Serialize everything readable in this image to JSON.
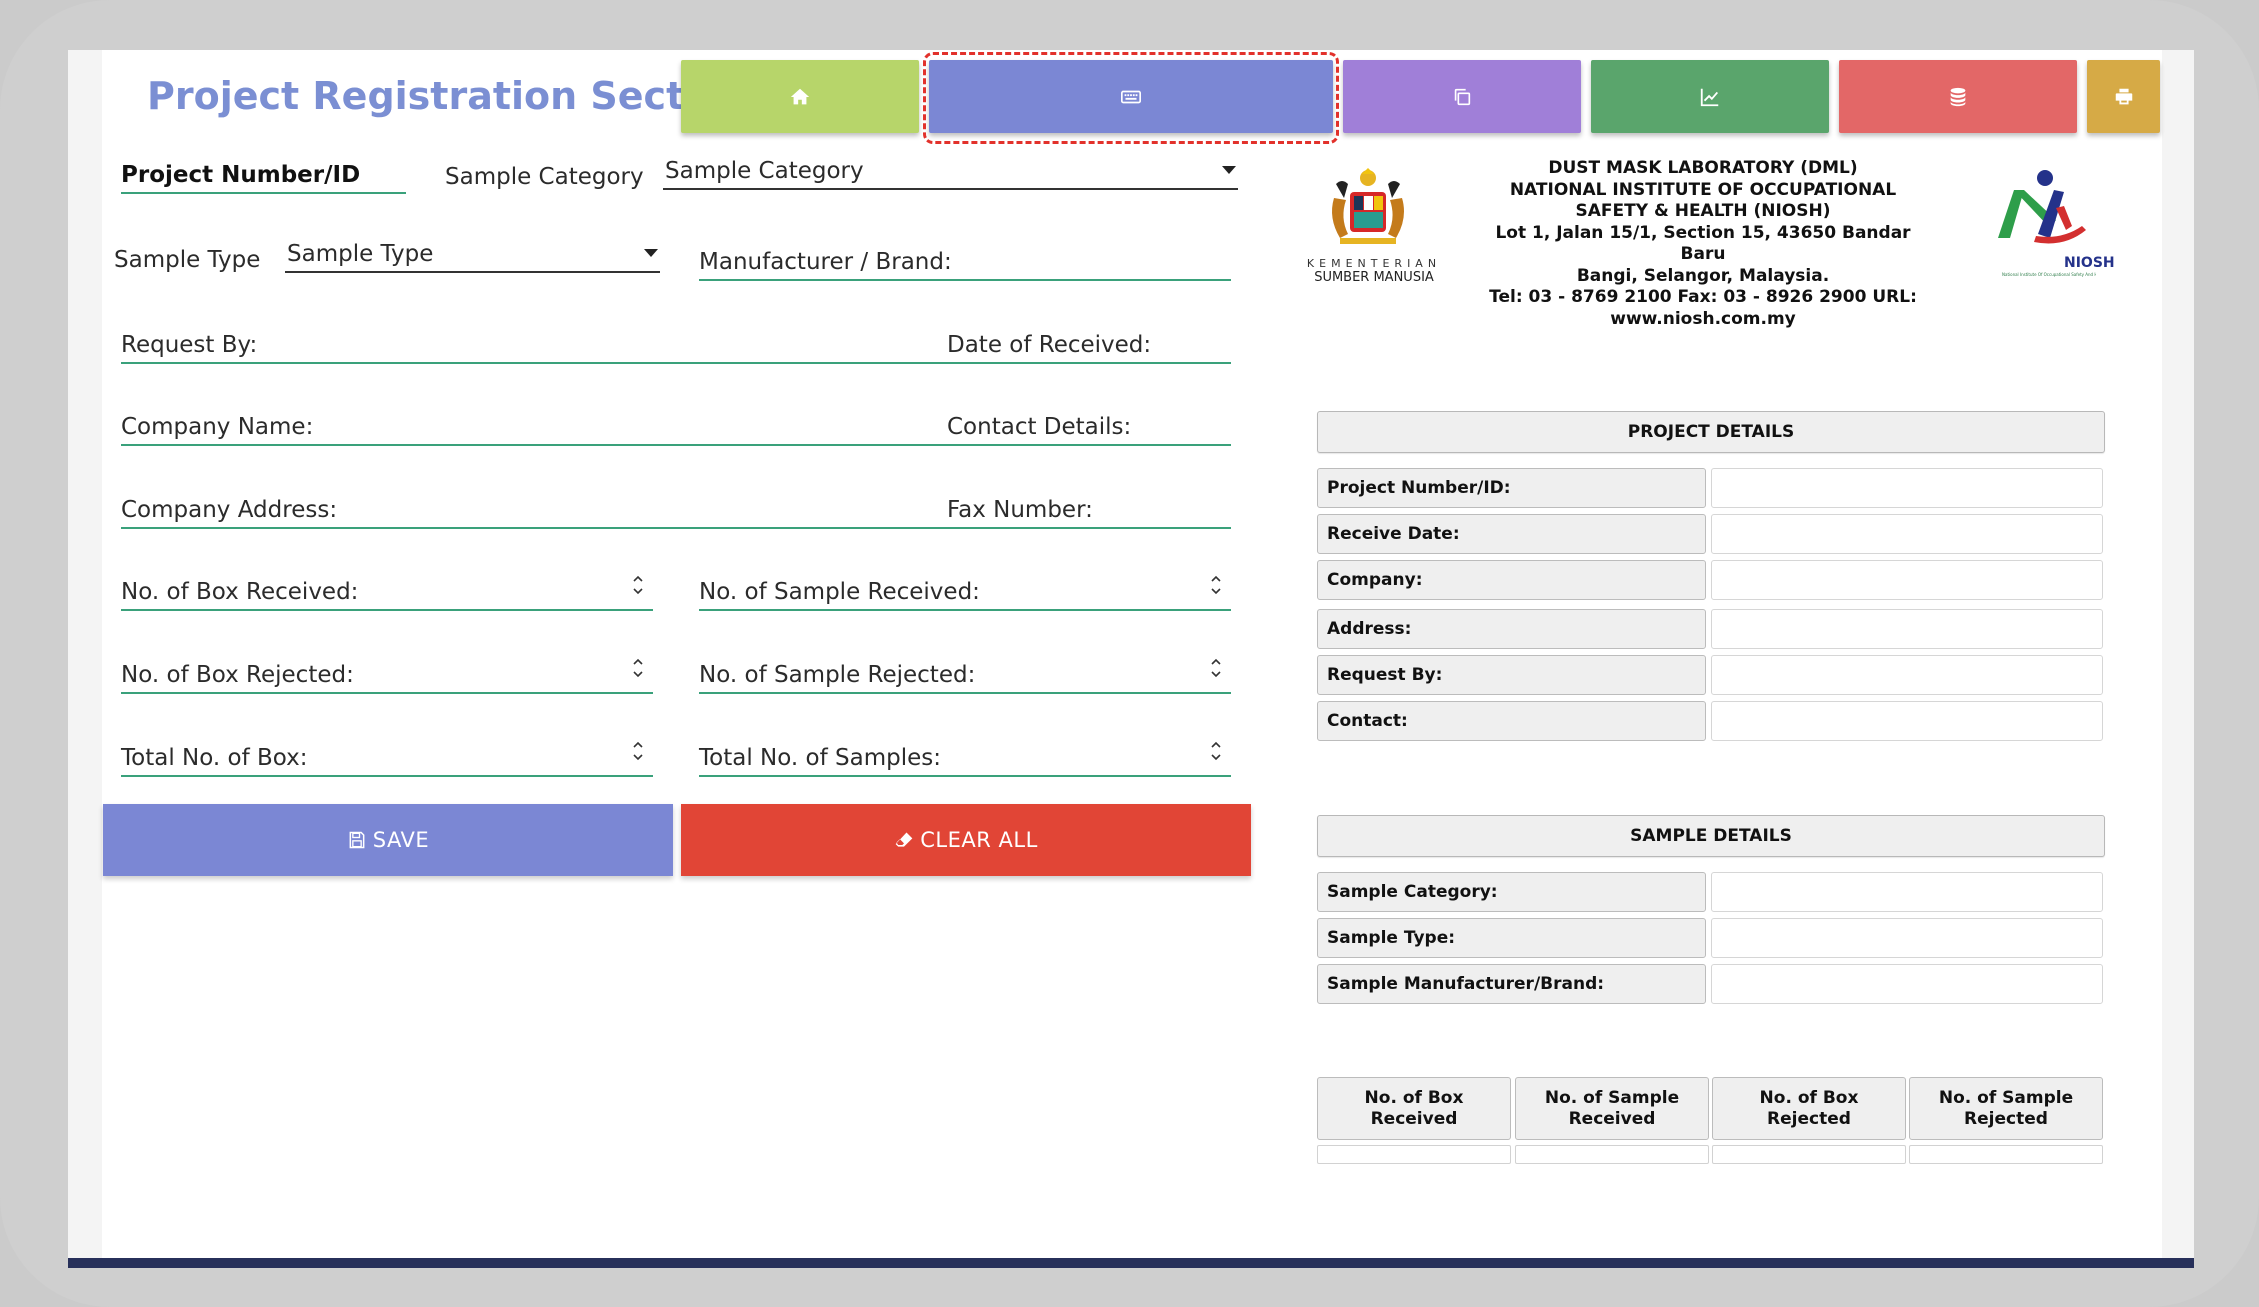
{
  "page": {
    "title": "Project Registration Section"
  },
  "nav": {
    "buttons": [
      {
        "name": "home",
        "icon": "home-icon",
        "color": "#b7d56a"
      },
      {
        "name": "keyboard",
        "icon": "keyboard-icon",
        "color": "#7b87d4",
        "active": true
      },
      {
        "name": "copy",
        "icon": "copy-icon",
        "color": "#a07fd8"
      },
      {
        "name": "chart",
        "icon": "chart-line-icon",
        "color": "#5aa56c"
      },
      {
        "name": "database",
        "icon": "database-icon",
        "color": "#e36767"
      },
      {
        "name": "print",
        "icon": "print-icon",
        "color": "#d6aa46"
      }
    ]
  },
  "form": {
    "project_number": "Project Number/ID",
    "sample_category_label": "Sample Category",
    "sample_category_select": "Sample Category",
    "sample_type_label": "Sample Type",
    "sample_type_select": "Sample Type",
    "manufacturer": "Manufacturer / Brand:",
    "request_by": "Request By:",
    "date_received": "Date of Received:",
    "company_name": "Company Name:",
    "contact_details": "Contact Details:",
    "company_address": "Company Address:",
    "fax_number": "Fax Number:",
    "box_received": "No. of Box Received:",
    "sample_received": "No. of Sample Received:",
    "box_rejected": "No. of Box Rejected:",
    "sample_rejected": "No. of Sample Rejected:",
    "total_box": "Total No. of Box:",
    "total_samples": "Total No. of Samples:"
  },
  "actions": {
    "save_label": "SAVE",
    "clear_label": "CLEAR ALL",
    "save_color": "#7b87d4",
    "clear_color": "#e14536"
  },
  "header": {
    "ministry_line1": "KEMENTERIAN",
    "ministry_line2": "SUMBER MANUSIA",
    "lab_name": "DUST MASK LABORATORY (DML)",
    "institute": "NATIONAL INSTITUTE OF OCCUPATIONAL SAFETY & HEALTH (NIOSH)",
    "address1": "Lot 1, Jalan 15/1, Section 15, 43650 Bandar Baru",
    "address2": "Bangi, Selangor, Malaysia.",
    "phone": "Tel: 03 - 8769 2100 Fax: 03 - 8926 2900 URL:",
    "url": "www.niosh.com.my",
    "niosh_logo_text": "NIOSH",
    "niosh_logo_sub": "National Institute Of Occupational Safety And Health"
  },
  "project_details": {
    "title": "PROJECT DETAILS",
    "rows": [
      {
        "label": "Project Number/ID:",
        "value": ""
      },
      {
        "label": "Receive Date:",
        "value": ""
      },
      {
        "label": "Company:",
        "value": ""
      },
      {
        "label": "Address:",
        "value": ""
      },
      {
        "label": "Request By:",
        "value": ""
      },
      {
        "label": "Contact:",
        "value": ""
      }
    ]
  },
  "sample_details": {
    "title": "SAMPLE DETAILS",
    "rows": [
      {
        "label": "Sample Category:",
        "value": ""
      },
      {
        "label": "Sample Type:",
        "value": ""
      },
      {
        "label": "Sample Manufacturer/Brand:",
        "value": ""
      }
    ]
  },
  "counts_table": {
    "headers": [
      "No. of Box Received",
      "No. of Sample Received",
      "No. of Box Rejected",
      "No. of Sample Rejected"
    ],
    "values": [
      "",
      "",
      "",
      ""
    ]
  }
}
